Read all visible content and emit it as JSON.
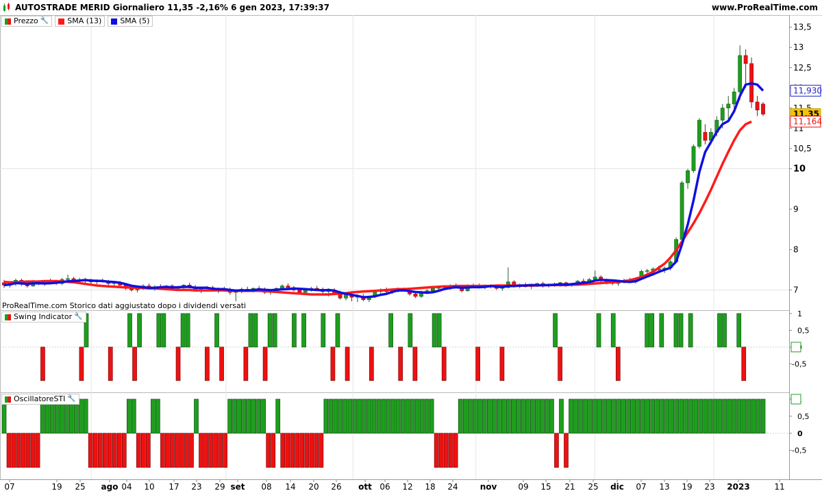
{
  "header": {
    "title": "AUTOSTRADE MERID Giornaliero 11,35 -2,16% 6 gen 2023, 17:39:37",
    "site": "www.ProRealTime.com"
  },
  "legend_price": [
    {
      "label": "Prezzo",
      "color": "#1e9e1e",
      "icon": "wrench-icon"
    },
    {
      "label": "SMA (13)",
      "color": "#ff0000"
    },
    {
      "label": "SMA (5)",
      "color": "#0000ee"
    }
  ],
  "legend_swing": {
    "label": "Swing Indicator",
    "icon": "wrench-icon"
  },
  "legend_osc": {
    "label": "OscillatoreSTI",
    "icon": "wrench-icon"
  },
  "note": "ProRealTime.com Storico dati aggiustato dopo i dividendi versati",
  "colors": {
    "up": "#1e9e1e",
    "down": "#ee1111",
    "sma13": "#ff1a1a",
    "sma5": "#1010e0"
  },
  "chart_data": [
    {
      "type": "candlestick",
      "title": "Prezzo",
      "ylim": [
        6.5,
        13.8
      ],
      "y_ticks": [
        "13,5",
        "13",
        "12,5",
        "12",
        "11,5",
        "11",
        "10,5",
        "10",
        "9",
        "8",
        "7"
      ],
      "x_ticks": [
        "07",
        "19",
        "25",
        "ago",
        "04",
        "10",
        "17",
        "23",
        "29",
        "set",
        "08",
        "14",
        "20",
        "26",
        "ott",
        "06",
        "12",
        "18",
        "24",
        "nov",
        "09",
        "15",
        "21",
        "25",
        "dic",
        "07",
        "13",
        "19",
        "23",
        "2023",
        "11"
      ],
      "price_labels": [
        {
          "text": "11,930",
          "value": 11.93,
          "style": "sma5"
        },
        {
          "text": "11,35",
          "value": 11.35,
          "style": "last"
        },
        {
          "text": "11,164",
          "value": 11.164,
          "style": "sma13"
        }
      ],
      "candles": [
        [
          7.18,
          7.25,
          7.05,
          7.12
        ],
        [
          7.12,
          7.22,
          7.06,
          7.15
        ],
        [
          7.15,
          7.28,
          7.1,
          7.24
        ],
        [
          7.24,
          7.28,
          7.1,
          7.14
        ],
        [
          7.14,
          7.2,
          7.06,
          7.1
        ],
        [
          7.1,
          7.25,
          7.08,
          7.2
        ],
        [
          7.2,
          7.24,
          7.12,
          7.16
        ],
        [
          7.16,
          7.22,
          7.1,
          7.2
        ],
        [
          7.2,
          7.28,
          7.14,
          7.18
        ],
        [
          7.18,
          7.22,
          7.12,
          7.16
        ],
        [
          7.16,
          7.3,
          7.12,
          7.26
        ],
        [
          7.26,
          7.38,
          7.2,
          7.28
        ],
        [
          7.28,
          7.32,
          7.18,
          7.22
        ],
        [
          7.22,
          7.3,
          7.16,
          7.25
        ],
        [
          7.25,
          7.3,
          7.18,
          7.22
        ],
        [
          7.22,
          7.28,
          7.16,
          7.2
        ],
        [
          7.2,
          7.26,
          7.14,
          7.24
        ],
        [
          7.24,
          7.28,
          7.18,
          7.2
        ],
        [
          7.2,
          7.25,
          7.12,
          7.16
        ],
        [
          7.16,
          7.2,
          7.1,
          7.18
        ],
        [
          7.18,
          7.22,
          7.08,
          7.12
        ],
        [
          7.12,
          7.16,
          7.0,
          7.06
        ],
        [
          7.06,
          7.12,
          6.96,
          7.0
        ],
        [
          7.0,
          7.1,
          6.94,
          7.06
        ],
        [
          7.06,
          7.14,
          7.0,
          7.1
        ],
        [
          7.1,
          7.16,
          7.02,
          7.04
        ],
        [
          7.04,
          7.12,
          6.98,
          7.08
        ],
        [
          7.08,
          7.14,
          7.02,
          7.06
        ],
        [
          7.06,
          7.12,
          7.0,
          7.1
        ],
        [
          7.1,
          7.14,
          7.02,
          7.04
        ],
        [
          7.04,
          7.1,
          6.98,
          7.06
        ],
        [
          7.06,
          7.14,
          7.0,
          7.12
        ],
        [
          7.12,
          7.18,
          7.04,
          7.06
        ],
        [
          7.06,
          7.12,
          6.96,
          7.0
        ],
        [
          7.0,
          7.08,
          6.92,
          7.04
        ],
        [
          7.04,
          7.1,
          6.98,
          7.06
        ],
        [
          7.06,
          7.1,
          6.96,
          6.98
        ],
        [
          6.98,
          7.06,
          6.92,
          7.02
        ],
        [
          7.02,
          7.08,
          6.96,
          7.0
        ],
        [
          7.0,
          7.06,
          6.88,
          6.94
        ],
        [
          6.94,
          7.0,
          6.72,
          6.98
        ],
        [
          6.98,
          7.06,
          6.92,
          7.02
        ],
        [
          7.02,
          7.08,
          6.96,
          7.0
        ],
        [
          7.0,
          7.06,
          6.94,
          7.04
        ],
        [
          7.04,
          7.1,
          6.98,
          7.02
        ],
        [
          7.02,
          7.06,
          6.9,
          6.94
        ],
        [
          6.94,
          7.02,
          6.88,
          6.98
        ],
        [
          6.98,
          7.06,
          6.94,
          7.04
        ],
        [
          7.04,
          7.14,
          7.0,
          7.1
        ],
        [
          7.1,
          7.16,
          7.02,
          7.06
        ],
        [
          7.06,
          7.1,
          6.96,
          7.0
        ],
        [
          7.0,
          7.06,
          6.9,
          6.94
        ],
        [
          6.94,
          7.04,
          6.88,
          7.0
        ],
        [
          7.0,
          7.08,
          6.96,
          7.04
        ],
        [
          7.04,
          7.1,
          6.98,
          7.02
        ],
        [
          7.02,
          7.06,
          6.92,
          6.96
        ],
        [
          6.96,
          7.04,
          6.84,
          6.98
        ],
        [
          6.98,
          7.04,
          6.9,
          6.92
        ],
        [
          6.92,
          6.98,
          6.76,
          6.8
        ],
        [
          6.8,
          6.92,
          6.74,
          6.88
        ],
        [
          6.88,
          6.94,
          6.72,
          6.82
        ],
        [
          6.82,
          6.9,
          6.7,
          6.84
        ],
        [
          6.84,
          6.9,
          6.72,
          6.76
        ],
        [
          6.76,
          6.86,
          6.7,
          6.84
        ],
        [
          6.84,
          6.98,
          6.8,
          6.96
        ],
        [
          6.96,
          7.04,
          6.9,
          7.0
        ],
        [
          7.0,
          7.06,
          6.92,
          6.96
        ],
        [
          6.96,
          7.04,
          6.9,
          7.0
        ],
        [
          7.0,
          7.06,
          6.94,
          7.02
        ],
        [
          7.02,
          7.06,
          6.96,
          6.98
        ],
        [
          6.98,
          7.02,
          6.86,
          6.9
        ],
        [
          6.9,
          6.96,
          6.8,
          6.84
        ],
        [
          6.84,
          6.98,
          6.8,
          6.96
        ],
        [
          6.96,
          7.02,
          6.9,
          6.98
        ],
        [
          6.98,
          7.06,
          6.94,
          7.04
        ],
        [
          7.04,
          7.1,
          7.0,
          7.08
        ],
        [
          7.08,
          7.12,
          7.0,
          7.06
        ],
        [
          7.06,
          7.14,
          7.0,
          7.1
        ],
        [
          7.1,
          7.16,
          7.04,
          7.06
        ],
        [
          7.06,
          7.12,
          6.94,
          6.98
        ],
        [
          6.98,
          7.14,
          6.96,
          7.1
        ],
        [
          7.1,
          7.16,
          7.04,
          7.12
        ],
        [
          7.12,
          7.16,
          7.04,
          7.08
        ],
        [
          7.08,
          7.14,
          7.02,
          7.1
        ],
        [
          7.1,
          7.14,
          7.04,
          7.08
        ],
        [
          7.08,
          7.12,
          7.0,
          7.04
        ],
        [
          7.04,
          7.1,
          6.98,
          7.06
        ],
        [
          7.06,
          7.56,
          7.04,
          7.2
        ],
        [
          7.2,
          7.24,
          7.06,
          7.1
        ],
        [
          7.1,
          7.16,
          7.04,
          7.12
        ],
        [
          7.12,
          7.18,
          7.06,
          7.08
        ],
        [
          7.08,
          7.14,
          7.02,
          7.12
        ],
        [
          7.12,
          7.18,
          7.08,
          7.16
        ],
        [
          7.16,
          7.2,
          7.06,
          7.1
        ],
        [
          7.1,
          7.16,
          7.06,
          7.14
        ],
        [
          7.14,
          7.18,
          7.08,
          7.12
        ],
        [
          7.12,
          7.2,
          7.08,
          7.18
        ],
        [
          7.18,
          7.2,
          7.08,
          7.12
        ],
        [
          7.12,
          7.18,
          7.08,
          7.16
        ],
        [
          7.16,
          7.24,
          7.12,
          7.22
        ],
        [
          7.22,
          7.28,
          7.14,
          7.2
        ],
        [
          7.2,
          7.3,
          7.16,
          7.26
        ],
        [
          7.26,
          7.48,
          7.2,
          7.32
        ],
        [
          7.32,
          7.36,
          7.18,
          7.24
        ],
        [
          7.24,
          7.28,
          7.14,
          7.2
        ],
        [
          7.2,
          7.26,
          7.12,
          7.16
        ],
        [
          7.16,
          7.22,
          7.1,
          7.2
        ],
        [
          7.2,
          7.28,
          7.16,
          7.24
        ],
        [
          7.24,
          7.3,
          7.18,
          7.2
        ],
        [
          7.2,
          7.3,
          7.16,
          7.28
        ],
        [
          7.28,
          7.5,
          7.26,
          7.46
        ],
        [
          7.46,
          7.52,
          7.38,
          7.48
        ],
        [
          7.48,
          7.56,
          7.42,
          7.52
        ],
        [
          7.52,
          7.6,
          7.46,
          7.5
        ],
        [
          7.5,
          7.58,
          7.42,
          7.54
        ],
        [
          7.54,
          7.75,
          7.48,
          7.7
        ],
        [
          7.7,
          8.3,
          7.66,
          8.25
        ],
        [
          8.25,
          9.7,
          8.2,
          9.65
        ],
        [
          9.65,
          10.0,
          9.5,
          9.95
        ],
        [
          9.95,
          10.6,
          9.9,
          10.55
        ],
        [
          10.55,
          11.25,
          10.5,
          11.2
        ],
        [
          10.9,
          11.1,
          10.6,
          10.7
        ],
        [
          10.7,
          11.0,
          10.6,
          10.9
        ],
        [
          10.9,
          11.3,
          10.8,
          11.2
        ],
        [
          11.2,
          11.6,
          11.0,
          11.5
        ],
        [
          11.5,
          11.8,
          11.2,
          11.6
        ],
        [
          11.6,
          12.0,
          11.5,
          11.9
        ],
        [
          11.9,
          13.05,
          11.7,
          12.8
        ],
        [
          12.8,
          12.95,
          12.0,
          12.6
        ],
        [
          12.6,
          12.75,
          11.5,
          11.65
        ],
        [
          11.65,
          11.8,
          11.3,
          11.45
        ],
        [
          11.6,
          11.65,
          11.3,
          11.35
        ]
      ],
      "sma13": [
        7.2,
        7.19,
        7.19,
        7.2,
        7.21,
        7.21,
        7.21,
        7.22,
        7.22,
        7.22,
        7.21,
        7.2,
        7.19,
        7.17,
        7.15,
        7.13,
        7.11,
        7.1,
        7.09,
        7.08,
        7.07,
        7.06,
        7.06,
        7.05,
        7.05,
        7.04,
        7.04,
        7.03,
        7.02,
        7.01,
        7.0,
        7.0,
        7.0,
        6.99,
        6.99,
        6.99,
        6.99,
        6.99,
        6.99,
        6.98,
        6.98,
        6.98,
        6.98,
        6.98,
        6.98,
        6.97,
        6.96,
        6.95,
        6.94,
        6.93,
        6.92,
        6.91,
        6.9,
        6.89,
        6.89,
        6.89,
        6.89,
        6.9,
        6.91,
        6.92,
        6.94,
        6.95,
        6.96,
        6.97,
        6.98,
        6.99,
        7.0,
        7.01,
        7.02,
        7.02,
        7.03,
        7.04,
        7.05,
        7.06,
        7.07,
        7.08,
        7.09,
        7.09,
        7.1,
        7.1,
        7.1,
        7.1,
        7.1,
        7.1,
        7.1,
        7.11,
        7.11,
        7.11,
        7.11,
        7.11,
        7.11,
        7.11,
        7.11,
        7.12,
        7.12,
        7.12,
        7.12,
        7.12,
        7.13,
        7.13,
        7.14,
        7.15,
        7.16,
        7.17,
        7.18,
        7.19,
        7.2,
        7.22,
        7.24,
        7.28,
        7.32,
        7.38,
        7.45,
        7.55,
        7.65,
        7.8,
        7.98,
        8.2,
        8.42,
        8.65,
        8.9,
        9.18,
        9.48,
        9.8,
        10.12,
        10.42,
        10.7,
        10.95,
        11.1,
        11.164
      ]
    }
  ],
  "swing": {
    "ylim": [
      -1.35,
      1.1
    ],
    "y_ticks": [
      "1",
      "0,5",
      "0",
      "-0,5"
    ],
    "values": [
      0,
      0,
      0,
      0,
      0,
      0,
      0,
      0,
      -1,
      0,
      0,
      0,
      0,
      0,
      0,
      0,
      -1,
      1,
      0,
      0,
      0,
      0,
      -1,
      0,
      0,
      0,
      1,
      -1,
      1,
      0,
      0,
      0,
      1,
      1,
      0,
      0,
      -1,
      1,
      1,
      0,
      0,
      0,
      -1,
      0,
      1,
      -1,
      0,
      0,
      0,
      0,
      -1,
      1,
      1,
      0,
      -1,
      1,
      1,
      0,
      0,
      0,
      1,
      0,
      1,
      0,
      0,
      0,
      1,
      0,
      -1,
      1,
      0,
      -1,
      0,
      0,
      0,
      0,
      -1,
      0,
      0,
      0,
      1,
      0,
      -1,
      0,
      1,
      -1,
      0,
      0,
      0,
      1,
      1,
      -1,
      0,
      0,
      0,
      0,
      0,
      0,
      -1,
      0,
      0,
      0,
      0,
      -1,
      0,
      0,
      0,
      0,
      0,
      0,
      0,
      0,
      0,
      0,
      1,
      -1,
      0,
      0,
      0,
      0,
      0,
      0,
      0,
      1,
      0,
      0,
      1,
      -1,
      0,
      0,
      0,
      0,
      0,
      1,
      1,
      0,
      1,
      0,
      0,
      1,
      1,
      0,
      1,
      0,
      0,
      0,
      0,
      0,
      1,
      1,
      0,
      0,
      1,
      -1,
      0,
      0,
      0,
      0
    ]
  },
  "osc": {
    "ylim": [
      -1.35,
      1.2
    ],
    "y_ticks": [
      "1",
      "0,5",
      "0",
      "-0,5"
    ],
    "values": [
      1,
      -1,
      -1,
      -1,
      -1,
      -1,
      -1,
      -1,
      1,
      1,
      1,
      1,
      1,
      1,
      1,
      1,
      1,
      1,
      -1,
      -1,
      -1,
      -1,
      -1,
      -1,
      -1,
      -1,
      1,
      1,
      -1,
      -1,
      -1,
      1,
      1,
      -1,
      -1,
      -1,
      -1,
      -1,
      -1,
      -1,
      1,
      -1,
      -1,
      -1,
      -1,
      -1,
      -1,
      1,
      1,
      1,
      1,
      1,
      1,
      1,
      1,
      -1,
      -1,
      1,
      -1,
      -1,
      -1,
      -1,
      -1,
      -1,
      -1,
      -1,
      -1,
      1,
      1,
      1,
      1,
      1,
      1,
      1,
      1,
      1,
      1,
      1,
      1,
      1,
      1,
      1,
      1,
      1,
      1,
      1,
      1,
      1,
      1,
      1,
      -1,
      -1,
      -1,
      -1,
      -1,
      1,
      1,
      1,
      1,
      1,
      1,
      1,
      1,
      1,
      1,
      1,
      1,
      1,
      1,
      1,
      1,
      1,
      1,
      1,
      1,
      -1,
      1,
      -1,
      1,
      1,
      1,
      1,
      1,
      1,
      1,
      1,
      1,
      1,
      1,
      1,
      1,
      1,
      1,
      1,
      1,
      1,
      1,
      1,
      1,
      1,
      1,
      1,
      1,
      1,
      1,
      1,
      1,
      1,
      1,
      1,
      1,
      1,
      1,
      1,
      1,
      1,
      1,
      1,
      1
    ]
  }
}
